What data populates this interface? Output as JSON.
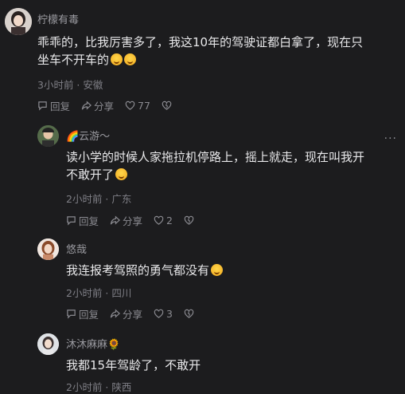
{
  "comments": [
    {
      "user": "柠檬有毒",
      "text1": "乖乖的，比我厉害多了，我这10年的驾驶证都白拿了，现在只",
      "text2": "坐车不开车的",
      "meta": "3小时前 · 安徽",
      "reply_label": "回复",
      "share_label": "分享",
      "like_count": "77"
    },
    {
      "user": "🌈云游～",
      "text1": "读小学的时候人家拖拉机停路上，摇上就走，现在叫我开",
      "text2": "不敢开了",
      "meta": "2小时前 · 广东",
      "reply_label": "回复",
      "share_label": "分享",
      "like_count": "2"
    },
    {
      "user": "悠哉",
      "text1": "我连报考驾照的勇气都没有",
      "meta": "2小时前 · 四川",
      "reply_label": "回复",
      "share_label": "分享",
      "like_count": "3"
    },
    {
      "user": "沐沐麻麻🌻",
      "text1": "我都15年驾龄了，不敢开",
      "meta": "2小时前 · 陕西"
    }
  ],
  "more_label": "···"
}
